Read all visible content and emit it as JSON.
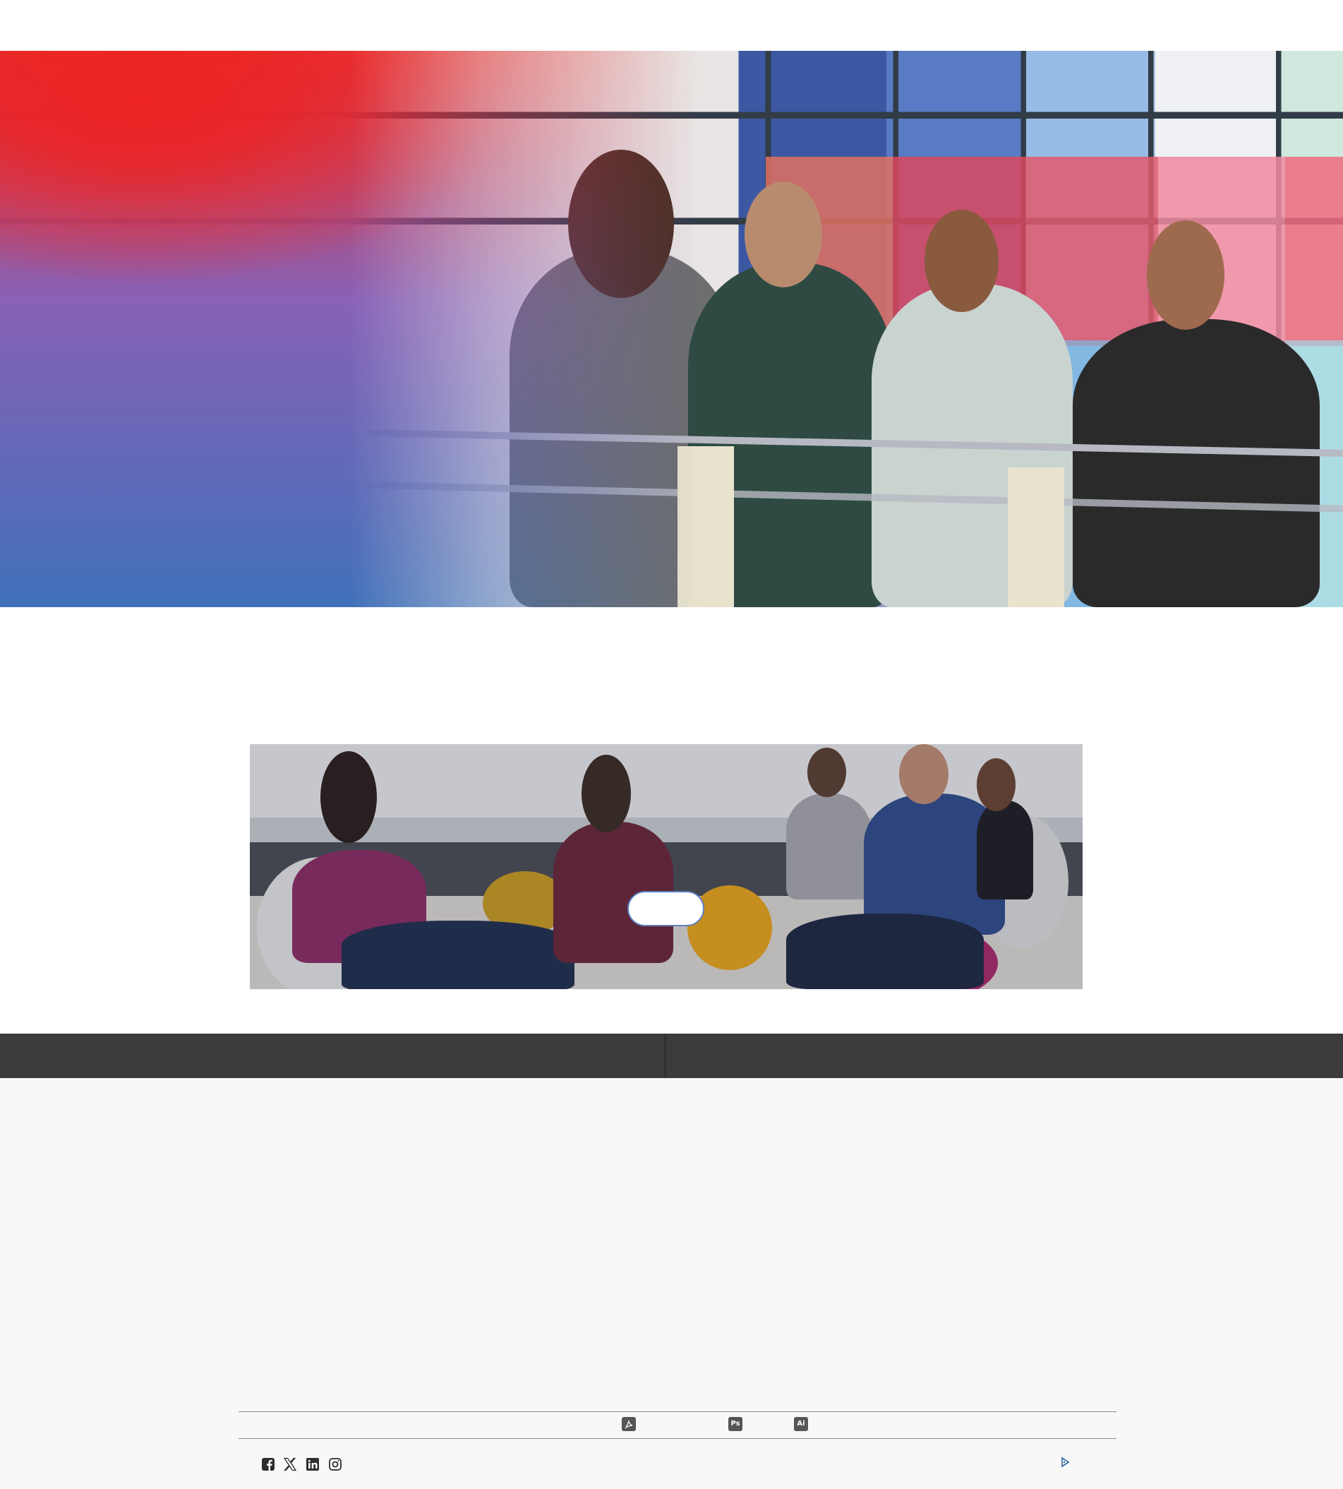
{
  "header": {},
  "hero": {},
  "promo": {},
  "footer": {
    "file_icons": [
      {
        "icon": "acrobat-pdf-icon",
        "label": ""
      },
      {
        "icon": "photoshop-icon",
        "label": "Ps"
      },
      {
        "icon": "illustrator-icon",
        "label": "Ai"
      }
    ],
    "social_icons": [
      "facebook-icon",
      "x-twitter-icon",
      "linkedin-icon",
      "instagram-icon"
    ],
    "ad_choices_icon": "ad-choices-icon"
  },
  "colors": {
    "hero_gradient_red": "#ec2424",
    "hero_gradient_purple": "#7a5fb8",
    "hero_gradient_blue": "#4070b9",
    "footer_bar": "#3b3b3b",
    "footer_bg": "#f8f8f8",
    "play_button_border": "#5b7fc2"
  }
}
